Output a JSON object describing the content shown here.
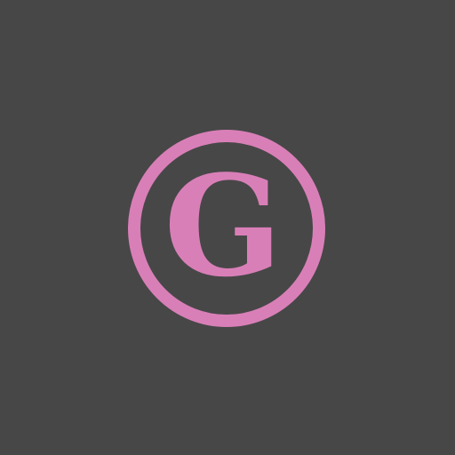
{
  "logo": {
    "icon": "g-in-circle-icon",
    "letter": "G",
    "color": "#d97fb8",
    "background": "#474747"
  }
}
